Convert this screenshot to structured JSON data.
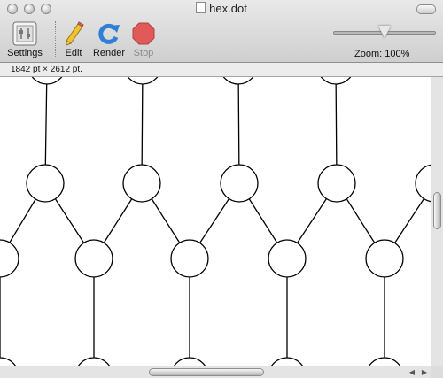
{
  "window": {
    "title": "hex.dot"
  },
  "toolbar": {
    "settings_label": "Settings",
    "edit_label": "Edit",
    "render_label": "Render",
    "stop_label": "Stop",
    "zoom_label": "Zoom: 100%",
    "zoom_fraction": 0.5
  },
  "status": {
    "size_text": "1842 pt × 2612 pt."
  },
  "colors": {
    "stop_red": "#e05a5a",
    "render_blue": "#2f7fd6"
  },
  "graph": {
    "node_count": 22,
    "description_shape": "hexagonal lattice of circles"
  }
}
